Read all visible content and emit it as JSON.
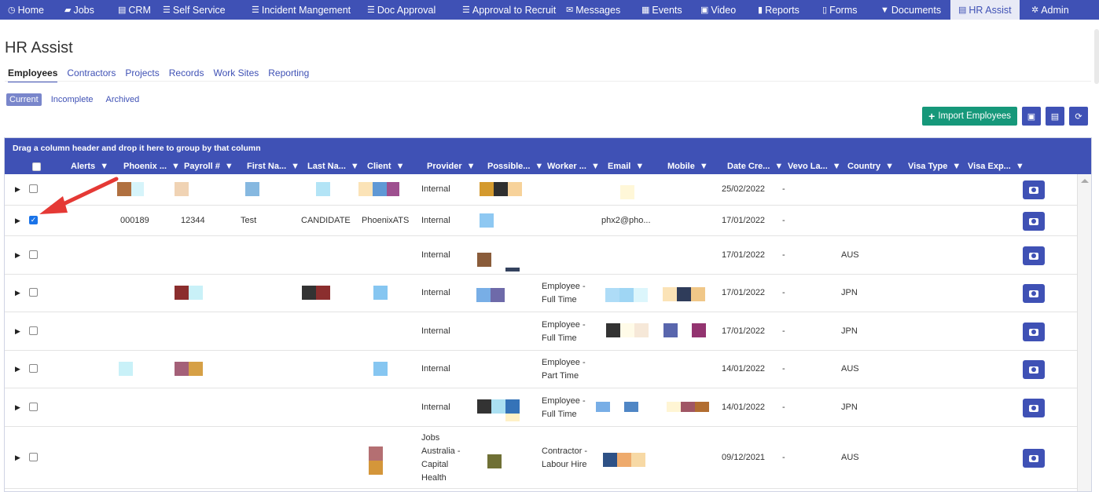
{
  "nav": [
    {
      "icon": "clock-icon",
      "glyph": "◷",
      "label": "Home"
    },
    {
      "icon": "folder-icon",
      "glyph": "▰",
      "label": "Jobs"
    },
    {
      "icon": "briefcase-icon",
      "glyph": "▤",
      "label": "CRM"
    },
    {
      "icon": "list-icon",
      "glyph": "☰",
      "label": "Self Service"
    },
    {
      "icon": "list-icon",
      "glyph": "☰",
      "label": "Incident Mangement"
    },
    {
      "icon": "list-icon",
      "glyph": "☰",
      "label": "Doc Approval"
    },
    {
      "icon": "list-icon",
      "glyph": "☰",
      "label": "Approval to Recruit"
    },
    {
      "icon": "envelope-icon",
      "glyph": "✉",
      "label": "Messages"
    },
    {
      "icon": "calendar-icon",
      "glyph": "▦",
      "label": "Events"
    },
    {
      "icon": "video-icon",
      "glyph": "▣",
      "label": "Video"
    },
    {
      "icon": "report-icon",
      "glyph": "▮",
      "label": "Reports"
    },
    {
      "icon": "file-icon",
      "glyph": "▯",
      "label": "Forms"
    },
    {
      "icon": "filter-icon",
      "glyph": "▼",
      "label": "Documents"
    },
    {
      "icon": "briefcase-icon",
      "glyph": "▤",
      "label": "HR Assist"
    },
    {
      "icon": "gear-icon",
      "glyph": "✲",
      "label": "Admin"
    }
  ],
  "page_title": "HR Assist",
  "tabs": [
    "Employees",
    "Contractors",
    "Projects",
    "Records",
    "Work Sites",
    "Reporting"
  ],
  "subtabs": [
    "Current",
    "Incomplete",
    "Archived"
  ],
  "toolbar": {
    "import_label": "Import Employees"
  },
  "grid": {
    "group_hint": "Drag a column header and drop it here to group by that column",
    "columns": [
      "Alerts",
      "Phoenix ...",
      "Payroll #",
      "First Na...",
      "Last Na...",
      "Client",
      "Provider",
      "Possible...",
      "Worker ...",
      "Email",
      "Mobile",
      "Date Cre...",
      "Vevo La...",
      "Country",
      "Visa Type",
      "Visa Exp..."
    ],
    "rows": [
      {
        "checked": false,
        "phoenix": "",
        "payroll": "",
        "first": "",
        "last": "",
        "client": "",
        "provider": "Internal",
        "worker": "",
        "email": "",
        "date": "25/02/2022",
        "vevo": "-",
        "country": ""
      },
      {
        "checked": true,
        "phoenix": "000189",
        "payroll": "12344",
        "first": "Test",
        "last": "CANDIDATE",
        "client": "PhoenixATS",
        "provider": "Internal",
        "worker": "",
        "email": "phx2@pho...",
        "date": "17/01/2022",
        "vevo": "-",
        "country": ""
      },
      {
        "checked": false,
        "phoenix": "",
        "payroll": "",
        "first": "",
        "last": "",
        "client": "",
        "provider": "Internal",
        "worker": "",
        "email": "",
        "date": "17/01/2022",
        "vevo": "-",
        "country": "AUS"
      },
      {
        "checked": false,
        "phoenix": "",
        "payroll": "",
        "first": "",
        "last": "",
        "client": "",
        "provider": "Internal",
        "worker": "Employee -\nFull Time",
        "email": "",
        "date": "17/01/2022",
        "vevo": "-",
        "country": "JPN"
      },
      {
        "checked": false,
        "phoenix": "",
        "payroll": "",
        "first": "",
        "last": "",
        "client": "",
        "provider": "Internal",
        "worker": "Employee -\nFull Time",
        "email": "",
        "date": "17/01/2022",
        "vevo": "-",
        "country": "JPN"
      },
      {
        "checked": false,
        "phoenix": "",
        "payroll": "",
        "first": "",
        "last": "",
        "client": "",
        "provider": "Internal",
        "worker": "Employee -\nPart Time",
        "email": "",
        "date": "14/01/2022",
        "vevo": "-",
        "country": "AUS"
      },
      {
        "checked": false,
        "phoenix": "",
        "payroll": "",
        "first": "",
        "last": "",
        "client": "",
        "provider": "Internal",
        "worker": "Employee -\nFull Time",
        "email": "",
        "date": "14/01/2022",
        "vevo": "-",
        "country": "JPN"
      },
      {
        "checked": false,
        "phoenix": "",
        "payroll": "",
        "first": "",
        "last": "",
        "client": "",
        "provider": "Jobs\nAustralia -\nCapital\nHealth",
        "worker": "Contractor -\nLabour Hire",
        "email": "",
        "date": "09/12/2021",
        "vevo": "-",
        "country": "AUS"
      }
    ]
  },
  "colors": {
    "nav_bg": "#3f51b5",
    "accent": "#3f51b5",
    "import_btn": "#16987a",
    "annotation_arrow": "#e53935"
  }
}
